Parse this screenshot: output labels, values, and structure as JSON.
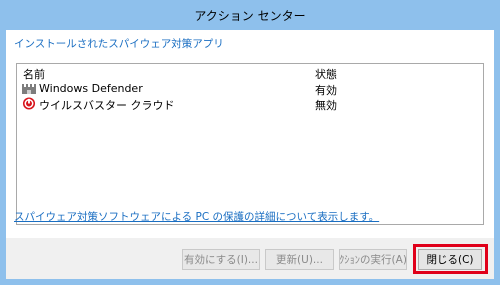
{
  "window": {
    "title": "アクション センター"
  },
  "header": {
    "text": "インストールされたスパイウェア対策アプリ"
  },
  "list": {
    "columns": {
      "name": "名前",
      "status": "状態"
    },
    "rows": [
      {
        "name": "Windows Defender",
        "status": "有効",
        "icon": "defender-castle-icon"
      },
      {
        "name": "ウイルスバスター クラウド",
        "status": "無効",
        "icon": "virusbuster-icon"
      }
    ]
  },
  "footer": {
    "link": "スパイウェア対策ソフトウェアによる PC の保護の詳細について表示します。"
  },
  "buttons": {
    "enable": "有効にする(I)...",
    "update": "更新(U)...",
    "run_action": "ｸｼｮﾝの実行(A)",
    "close": "閉じる(C)"
  },
  "colors": {
    "link": "#1a6ec2",
    "highlight": "#e0001a",
    "frame": "#8ec0ec"
  }
}
